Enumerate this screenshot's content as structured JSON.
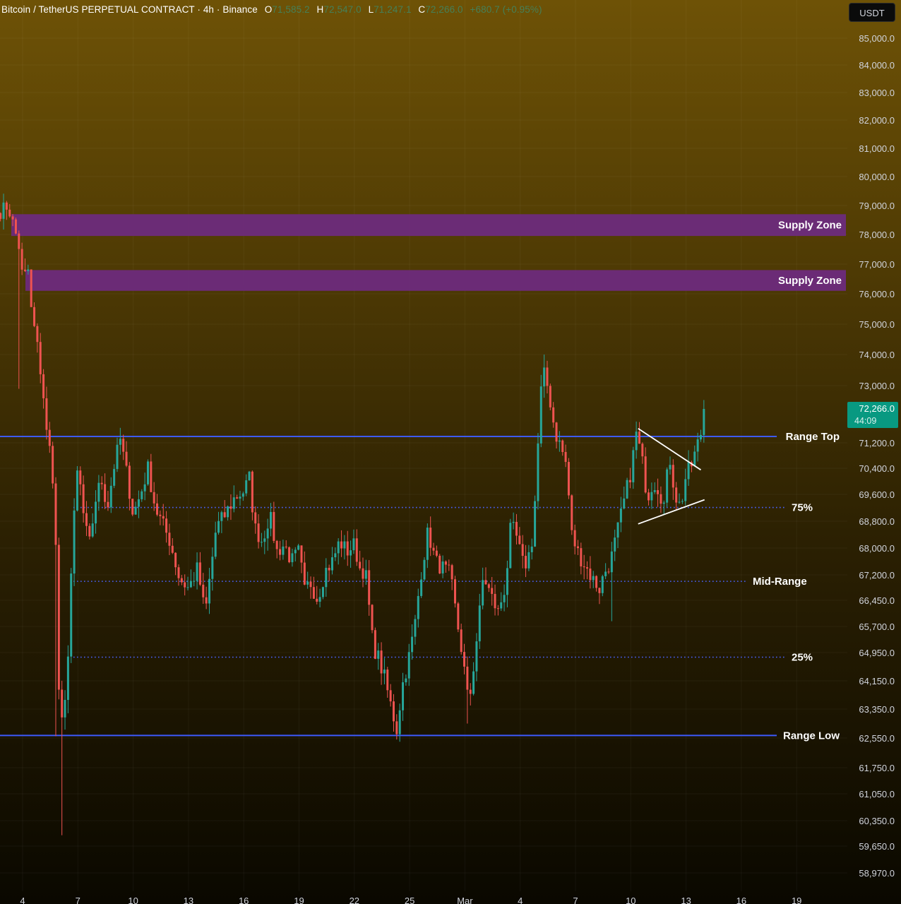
{
  "header": {
    "symbol": "Bitcoin / TetherUS PERPETUAL CONTRACT · 4h · Binance",
    "o_label": "O",
    "o_value": "71,585.2",
    "h_label": "H",
    "h_value": "72,547.0",
    "l_label": "L",
    "l_value": "71,247.1",
    "c_label": "C",
    "c_value": "72,266.0",
    "change": "+680.7 (+0.95%)"
  },
  "currency": "USDT",
  "colors": {
    "up": "#26a69a",
    "down": "#ef5350",
    "zone": "#6e2a80",
    "range_line": "#3d5afe",
    "level_dots": "#4a63ff",
    "triangle": "#ffffff",
    "axis_text": "#d1d4dc",
    "last_price_bg": "#089981"
  },
  "chart_data": {
    "type": "candlestick",
    "y_ticks": [
      {
        "label": "85,000.0",
        "v": 85000
      },
      {
        "label": "84,000.0",
        "v": 84000
      },
      {
        "label": "83,000.0",
        "v": 83000
      },
      {
        "label": "82,000.0",
        "v": 82000
      },
      {
        "label": "81,000.0",
        "v": 81000
      },
      {
        "label": "80,000.0",
        "v": 80000
      },
      {
        "label": "79,000.0",
        "v": 79000
      },
      {
        "label": "78,000.0",
        "v": 78000
      },
      {
        "label": "77,000.0",
        "v": 77000
      },
      {
        "label": "76,000.0",
        "v": 76000
      },
      {
        "label": "75,000.0",
        "v": 75000
      },
      {
        "label": "74,000.0",
        "v": 74000
      },
      {
        "label": "73,000.0",
        "v": 73000
      },
      {
        "label": "71,200.0",
        "v": 71200
      },
      {
        "label": "70,400.0",
        "v": 70400
      },
      {
        "label": "69,600.0",
        "v": 69600
      },
      {
        "label": "68,800.0",
        "v": 68800
      },
      {
        "label": "68,000.0",
        "v": 68000
      },
      {
        "label": "67,200.0",
        "v": 67200
      },
      {
        "label": "66,450.0",
        "v": 66450
      },
      {
        "label": "65,700.0",
        "v": 65700
      },
      {
        "label": "64,950.0",
        "v": 64950
      },
      {
        "label": "64,150.0",
        "v": 64150
      },
      {
        "label": "63,350.0",
        "v": 63350
      },
      {
        "label": "62,550.0",
        "v": 62550
      },
      {
        "label": "61,750.0",
        "v": 61750
      },
      {
        "label": "61,050.0",
        "v": 61050
      },
      {
        "label": "60,350.0",
        "v": 60350
      },
      {
        "label": "59,650.0",
        "v": 59650
      },
      {
        "label": "58,970.0",
        "v": 58970
      }
    ],
    "x_ticks": [
      {
        "label": "4",
        "d": 0
      },
      {
        "label": "7",
        "d": 3
      },
      {
        "label": "10",
        "d": 6
      },
      {
        "label": "13",
        "d": 9
      },
      {
        "label": "16",
        "d": 12
      },
      {
        "label": "19",
        "d": 15
      },
      {
        "label": "22",
        "d": 18
      },
      {
        "label": "25",
        "d": 21
      },
      {
        "label": "Mar",
        "d": 24
      },
      {
        "label": "4",
        "d": 27
      },
      {
        "label": "7",
        "d": 30
      },
      {
        "label": "10",
        "d": 33
      },
      {
        "label": "13",
        "d": 36
      },
      {
        "label": "16",
        "d": 39
      },
      {
        "label": "19",
        "d": 42
      }
    ],
    "zones": [
      {
        "label": "Supply Zone",
        "from": 77950,
        "to": 78700
      },
      {
        "label": "Supply Zone",
        "from": 76100,
        "to": 76800
      }
    ],
    "range_lines": [
      {
        "label": "Range Top",
        "value": 71400
      },
      {
        "label": "Range Low",
        "value": 62620
      }
    ],
    "levels": [
      {
        "label": "75%",
        "value": 69210
      },
      {
        "label": "Mid-Range",
        "value": 67010
      },
      {
        "label": "25%",
        "value": 64820
      }
    ],
    "triangle": [
      {
        "from": [
          33.4,
          71650
        ],
        "to": [
          36.8,
          70350
        ]
      },
      {
        "from": [
          33.4,
          68720
        ],
        "to": [
          37.0,
          69440
        ]
      }
    ],
    "last_price": {
      "label": "72,266.0",
      "countdown": "44:09",
      "value": 72266
    },
    "keypoints": [
      [
        -1.2,
        78800
      ],
      [
        -0.8,
        79000
      ],
      [
        -0.4,
        78100
      ],
      [
        -0.2,
        77600
      ],
      [
        0.0,
        76500
      ],
      [
        0.3,
        76800
      ],
      [
        0.5,
        75200
      ],
      [
        0.7,
        74700
      ],
      [
        0.9,
        73800
      ],
      [
        1.1,
        72900
      ],
      [
        1.3,
        71500
      ],
      [
        1.6,
        70600
      ],
      [
        1.8,
        68000
      ],
      [
        2.0,
        63100
      ],
      [
        2.2,
        62800
      ],
      [
        2.4,
        64100
      ],
      [
        2.6,
        66900
      ],
      [
        2.8,
        68900
      ],
      [
        3.0,
        70500
      ],
      [
        3.3,
        69000
      ],
      [
        3.6,
        68000
      ],
      [
        4.0,
        69600
      ],
      [
        4.3,
        70000
      ],
      [
        4.6,
        69200
      ],
      [
        5.0,
        70600
      ],
      [
        5.3,
        71300
      ],
      [
        5.6,
        70400
      ],
      [
        6.0,
        69000
      ],
      [
        6.4,
        69600
      ],
      [
        6.8,
        70400
      ],
      [
        7.2,
        69200
      ],
      [
        7.6,
        68700
      ],
      [
        8.0,
        68200
      ],
      [
        8.5,
        67100
      ],
      [
        9.0,
        66800
      ],
      [
        9.5,
        67400
      ],
      [
        9.9,
        66000
      ],
      [
        10.2,
        67300
      ],
      [
        10.5,
        68600
      ],
      [
        11.0,
        69000
      ],
      [
        11.5,
        69500
      ],
      [
        12.0,
        69700
      ],
      [
        12.3,
        70100
      ],
      [
        12.6,
        68600
      ],
      [
        13.0,
        68200
      ],
      [
        13.4,
        69000
      ],
      [
        13.8,
        67900
      ],
      [
        14.2,
        68100
      ],
      [
        14.6,
        67600
      ],
      [
        15.0,
        67900
      ],
      [
        15.3,
        66700
      ],
      [
        15.6,
        67000
      ],
      [
        16.0,
        66500
      ],
      [
        16.4,
        67300
      ],
      [
        16.8,
        67600
      ],
      [
        17.2,
        68200
      ],
      [
        17.6,
        67900
      ],
      [
        18.0,
        68100
      ],
      [
        18.3,
        67400
      ],
      [
        18.6,
        67300
      ],
      [
        19.0,
        65200
      ],
      [
        19.3,
        64800
      ],
      [
        19.6,
        64300
      ],
      [
        20.0,
        63400
      ],
      [
        20.3,
        62800
      ],
      [
        20.6,
        64000
      ],
      [
        21.0,
        64900
      ],
      [
        21.3,
        65800
      ],
      [
        21.6,
        67200
      ],
      [
        22.0,
        68500
      ],
      [
        22.4,
        67600
      ],
      [
        22.8,
        67400
      ],
      [
        23.2,
        67200
      ],
      [
        23.5,
        66100
      ],
      [
        23.8,
        65100
      ],
      [
        24.0,
        64300
      ],
      [
        24.2,
        63400
      ],
      [
        24.5,
        64700
      ],
      [
        24.8,
        66100
      ],
      [
        25.0,
        67200
      ],
      [
        25.4,
        66600
      ],
      [
        25.8,
        66100
      ],
      [
        26.2,
        66900
      ],
      [
        26.5,
        68700
      ],
      [
        26.8,
        68300
      ],
      [
        27.2,
        67400
      ],
      [
        27.6,
        68000
      ],
      [
        27.8,
        69400
      ],
      [
        28.0,
        71500
      ],
      [
        28.2,
        73500
      ],
      [
        28.4,
        73200
      ],
      [
        28.6,
        72600
      ],
      [
        28.9,
        71500
      ],
      [
        29.2,
        71100
      ],
      [
        29.5,
        70500
      ],
      [
        29.8,
        68400
      ],
      [
        30.1,
        67900
      ],
      [
        30.5,
        67500
      ],
      [
        30.9,
        67100
      ],
      [
        31.3,
        66800
      ],
      [
        31.6,
        67300
      ],
      [
        31.9,
        67600
      ],
      [
        32.2,
        68300
      ],
      [
        32.6,
        69300
      ],
      [
        33.0,
        70300
      ],
      [
        33.3,
        71500
      ],
      [
        33.6,
        70700
      ],
      [
        33.9,
        69500
      ],
      [
        34.2,
        70000
      ],
      [
        34.5,
        69800
      ],
      [
        34.8,
        69300
      ],
      [
        35.1,
        70800
      ],
      [
        35.4,
        69600
      ],
      [
        35.7,
        69200
      ],
      [
        36.0,
        70200
      ],
      [
        36.3,
        70500
      ],
      [
        36.6,
        71100
      ],
      [
        36.8,
        71500
      ],
      [
        37.0,
        72266
      ]
    ],
    "extremes": [
      {
        "x": 2.2,
        "low": 59950
      },
      {
        "x": 1.85,
        "low": 62600
      },
      {
        "x": 20.45,
        "low": 62450
      },
      {
        "x": 28.25,
        "high": 74000
      },
      {
        "x": 37.0,
        "high": 72547
      },
      {
        "x": 24.1,
        "low": 62950
      },
      {
        "x": 32.0,
        "low": 65850
      },
      {
        "x": -0.2,
        "low": 72900
      },
      {
        "x": -0.8,
        "high": 79150
      }
    ]
  }
}
